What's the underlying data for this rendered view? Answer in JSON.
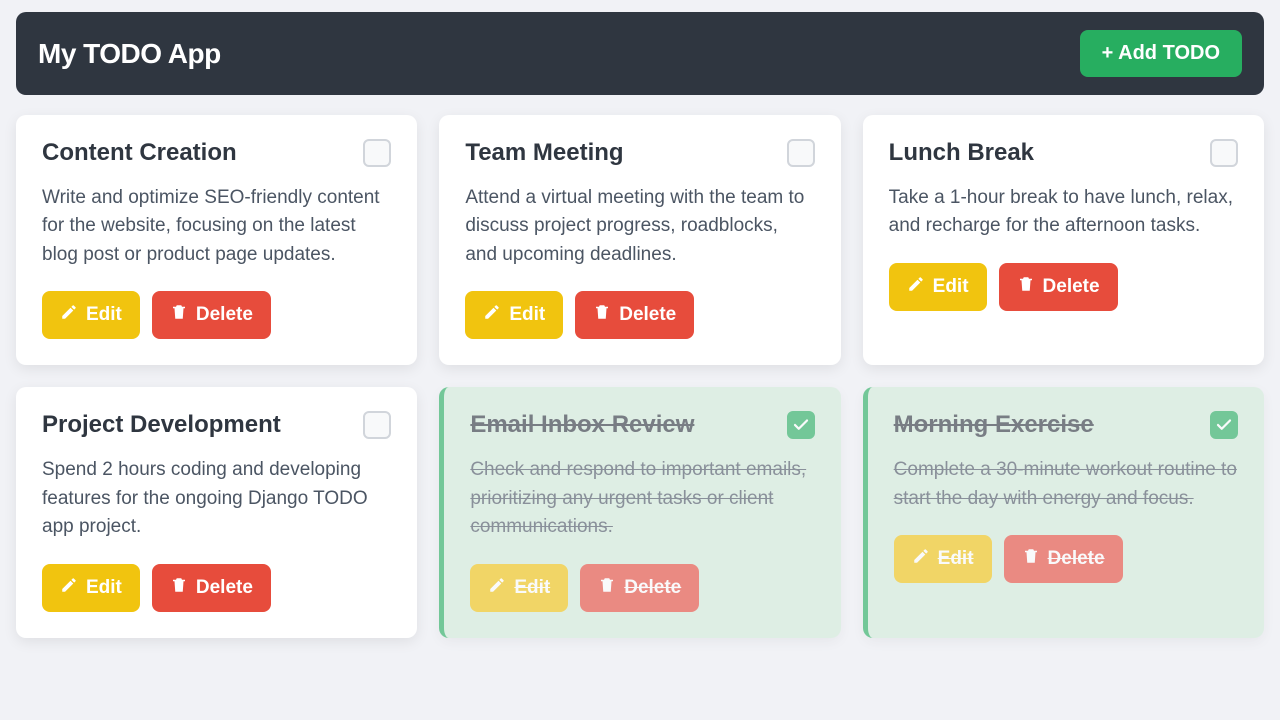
{
  "header": {
    "title": "My TODO App",
    "add_label": "+ Add TODO"
  },
  "buttons": {
    "edit": "Edit",
    "delete": "Delete"
  },
  "colors": {
    "header_bg": "#2f3640",
    "add_btn": "#27ae60",
    "edit_btn": "#f1c40f",
    "delete_btn": "#e74c3c",
    "done_bg": "#d4edda",
    "page_bg": "#f1f2f6"
  },
  "todos": [
    {
      "title": "Content Creation",
      "description": "Write and optimize SEO-friendly content for the website, focusing on the latest blog post or product page updates.",
      "done": false
    },
    {
      "title": "Team Meeting",
      "description": "Attend a virtual meeting with the team to discuss project progress, roadblocks, and upcoming deadlines.",
      "done": false
    },
    {
      "title": "Lunch Break",
      "description": "Take a 1-hour break to have lunch, relax, and recharge for the afternoon tasks.",
      "done": false
    },
    {
      "title": "Project Development",
      "description": "Spend 2 hours coding and developing features for the ongoing Django TODO app project.",
      "done": false
    },
    {
      "title": "Email Inbox Review",
      "description": "Check and respond to important emails, prioritizing any urgent tasks or client communications.",
      "done": true
    },
    {
      "title": "Morning Exercise",
      "description": "Complete a 30-minute workout routine to start the day with energy and focus.",
      "done": true
    }
  ]
}
